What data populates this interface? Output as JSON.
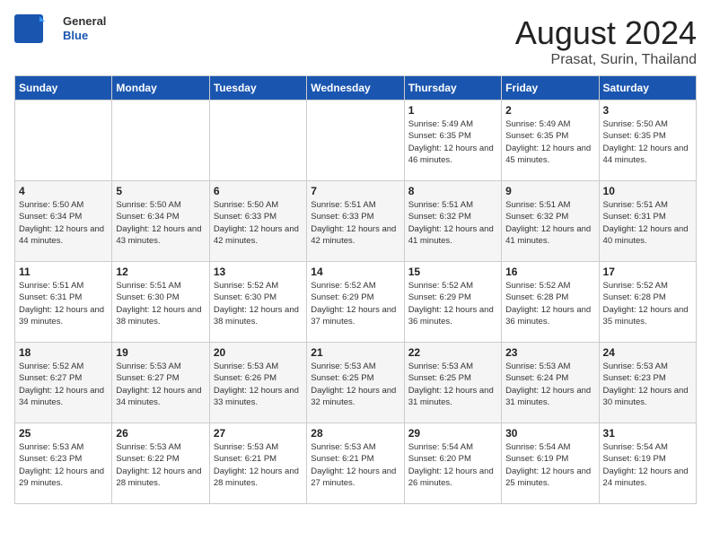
{
  "header": {
    "logo": {
      "general": "General",
      "blue": "Blue"
    },
    "title": "August 2024",
    "subtitle": "Prasat, Surin, Thailand"
  },
  "calendar": {
    "weekdays": [
      "Sunday",
      "Monday",
      "Tuesday",
      "Wednesday",
      "Thursday",
      "Friday",
      "Saturday"
    ],
    "weeks": [
      [
        {
          "day": "",
          "info": ""
        },
        {
          "day": "",
          "info": ""
        },
        {
          "day": "",
          "info": ""
        },
        {
          "day": "",
          "info": ""
        },
        {
          "day": "1",
          "info": "Sunrise: 5:49 AM\nSunset: 6:35 PM\nDaylight: 12 hours and 46 minutes."
        },
        {
          "day": "2",
          "info": "Sunrise: 5:49 AM\nSunset: 6:35 PM\nDaylight: 12 hours and 45 minutes."
        },
        {
          "day": "3",
          "info": "Sunrise: 5:50 AM\nSunset: 6:35 PM\nDaylight: 12 hours and 44 minutes."
        }
      ],
      [
        {
          "day": "4",
          "info": "Sunrise: 5:50 AM\nSunset: 6:34 PM\nDaylight: 12 hours and 44 minutes."
        },
        {
          "day": "5",
          "info": "Sunrise: 5:50 AM\nSunset: 6:34 PM\nDaylight: 12 hours and 43 minutes."
        },
        {
          "day": "6",
          "info": "Sunrise: 5:50 AM\nSunset: 6:33 PM\nDaylight: 12 hours and 42 minutes."
        },
        {
          "day": "7",
          "info": "Sunrise: 5:51 AM\nSunset: 6:33 PM\nDaylight: 12 hours and 42 minutes."
        },
        {
          "day": "8",
          "info": "Sunrise: 5:51 AM\nSunset: 6:32 PM\nDaylight: 12 hours and 41 minutes."
        },
        {
          "day": "9",
          "info": "Sunrise: 5:51 AM\nSunset: 6:32 PM\nDaylight: 12 hours and 41 minutes."
        },
        {
          "day": "10",
          "info": "Sunrise: 5:51 AM\nSunset: 6:31 PM\nDaylight: 12 hours and 40 minutes."
        }
      ],
      [
        {
          "day": "11",
          "info": "Sunrise: 5:51 AM\nSunset: 6:31 PM\nDaylight: 12 hours and 39 minutes."
        },
        {
          "day": "12",
          "info": "Sunrise: 5:51 AM\nSunset: 6:30 PM\nDaylight: 12 hours and 38 minutes."
        },
        {
          "day": "13",
          "info": "Sunrise: 5:52 AM\nSunset: 6:30 PM\nDaylight: 12 hours and 38 minutes."
        },
        {
          "day": "14",
          "info": "Sunrise: 5:52 AM\nSunset: 6:29 PM\nDaylight: 12 hours and 37 minutes."
        },
        {
          "day": "15",
          "info": "Sunrise: 5:52 AM\nSunset: 6:29 PM\nDaylight: 12 hours and 36 minutes."
        },
        {
          "day": "16",
          "info": "Sunrise: 5:52 AM\nSunset: 6:28 PM\nDaylight: 12 hours and 36 minutes."
        },
        {
          "day": "17",
          "info": "Sunrise: 5:52 AM\nSunset: 6:28 PM\nDaylight: 12 hours and 35 minutes."
        }
      ],
      [
        {
          "day": "18",
          "info": "Sunrise: 5:52 AM\nSunset: 6:27 PM\nDaylight: 12 hours and 34 minutes."
        },
        {
          "day": "19",
          "info": "Sunrise: 5:53 AM\nSunset: 6:27 PM\nDaylight: 12 hours and 34 minutes."
        },
        {
          "day": "20",
          "info": "Sunrise: 5:53 AM\nSunset: 6:26 PM\nDaylight: 12 hours and 33 minutes."
        },
        {
          "day": "21",
          "info": "Sunrise: 5:53 AM\nSunset: 6:25 PM\nDaylight: 12 hours and 32 minutes."
        },
        {
          "day": "22",
          "info": "Sunrise: 5:53 AM\nSunset: 6:25 PM\nDaylight: 12 hours and 31 minutes."
        },
        {
          "day": "23",
          "info": "Sunrise: 5:53 AM\nSunset: 6:24 PM\nDaylight: 12 hours and 31 minutes."
        },
        {
          "day": "24",
          "info": "Sunrise: 5:53 AM\nSunset: 6:23 PM\nDaylight: 12 hours and 30 minutes."
        }
      ],
      [
        {
          "day": "25",
          "info": "Sunrise: 5:53 AM\nSunset: 6:23 PM\nDaylight: 12 hours and 29 minutes."
        },
        {
          "day": "26",
          "info": "Sunrise: 5:53 AM\nSunset: 6:22 PM\nDaylight: 12 hours and 28 minutes."
        },
        {
          "day": "27",
          "info": "Sunrise: 5:53 AM\nSunset: 6:21 PM\nDaylight: 12 hours and 28 minutes."
        },
        {
          "day": "28",
          "info": "Sunrise: 5:53 AM\nSunset: 6:21 PM\nDaylight: 12 hours and 27 minutes."
        },
        {
          "day": "29",
          "info": "Sunrise: 5:54 AM\nSunset: 6:20 PM\nDaylight: 12 hours and 26 minutes."
        },
        {
          "day": "30",
          "info": "Sunrise: 5:54 AM\nSunset: 6:19 PM\nDaylight: 12 hours and 25 minutes."
        },
        {
          "day": "31",
          "info": "Sunrise: 5:54 AM\nSunset: 6:19 PM\nDaylight: 12 hours and 24 minutes."
        }
      ]
    ]
  }
}
